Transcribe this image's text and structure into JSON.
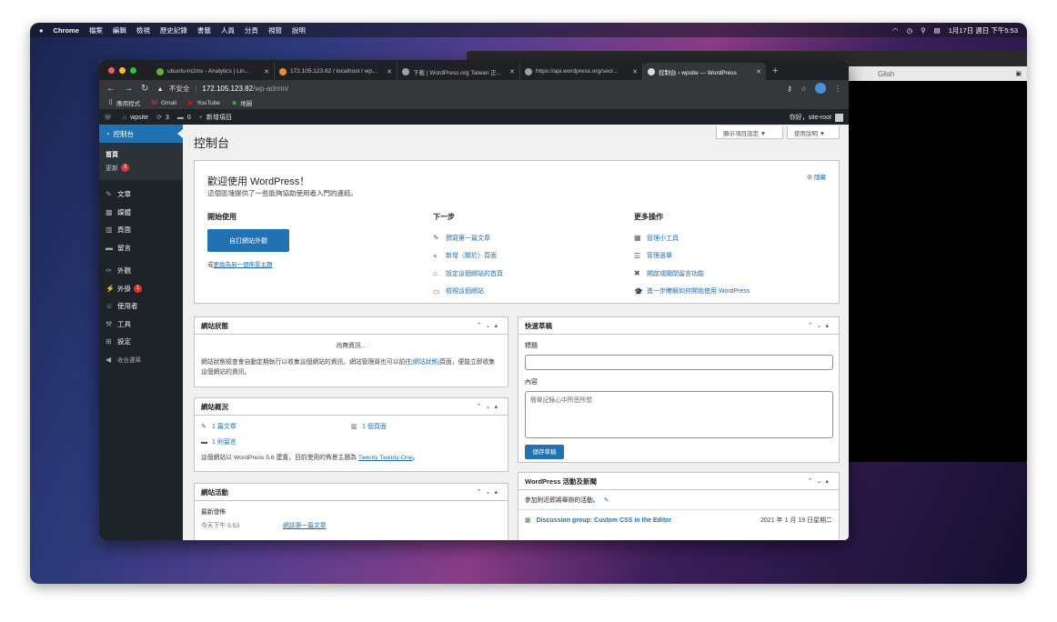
{
  "menubar": {
    "app_name": "Chrome",
    "menus": [
      "檔案",
      "編輯",
      "檢視",
      "歷史記錄",
      "書籤",
      "人員",
      "分頁",
      "視窗",
      "說明"
    ],
    "clock": "1月17日 週日 下午5:53"
  },
  "background_window": {
    "text": "Glish"
  },
  "browser": {
    "tabs": [
      {
        "title": "ubuntu-ln2ms - Analytics | Lin..."
      },
      {
        "title": "172.105.123.82 / localhost / wp..."
      },
      {
        "title": "下載 | WordPress.org Taiwan 正..."
      },
      {
        "title": "https://api.wordpress.org/secr..."
      },
      {
        "title": "控制台 ‹ wpsite — WordPress"
      }
    ],
    "insecure_label": "不安全",
    "url_host": "172.105.123.82",
    "url_path": "/wp-admin/",
    "bookmarks": [
      {
        "label": "應用程式",
        "icon": "apps-grid-icon"
      },
      {
        "label": "Gmail",
        "icon": "gmail-icon"
      },
      {
        "label": "YouTube",
        "icon": "youtube-icon"
      },
      {
        "label": "地圖",
        "icon": "maps-icon"
      }
    ]
  },
  "adminbar": {
    "site_name": "wpsite",
    "updates_count": "3",
    "comments_count": "0",
    "new_label": "新增項目",
    "greeting": "你好，site-root"
  },
  "sidebar": {
    "dashboard": "控制台",
    "home": "首頁",
    "updates": "更新",
    "updates_badge": "3",
    "posts": "文章",
    "media": "媒體",
    "pages": "頁面",
    "comments": "留言",
    "appearance": "外觀",
    "plugins": "外掛",
    "plugins_badge": "1",
    "users": "使用者",
    "tools": "工具",
    "settings": "設定",
    "collapse": "收合選單"
  },
  "page": {
    "title": "控制台",
    "screen_options": "顯示項目設定 ▼",
    "help": "使用說明 ▼"
  },
  "welcome": {
    "title": "歡迎使用 WordPress！",
    "about": "這個區塊提供了一些能夠協助使用者入門的連結。",
    "dismiss": "隱藏",
    "get_started": "開始使用",
    "customize_button": "自訂網站外觀",
    "or_prefix": "或",
    "change_theme_link": "更換為另一個佈景主題",
    "next_steps": "下一步",
    "next_links": [
      "撰寫第一篇文章",
      "新增〈關於〉頁面",
      "設定這個網站的首頁",
      "檢視這個網站"
    ],
    "more_actions": "更多操作",
    "more_links": [
      "管理小工具",
      "管理選單",
      "開啟或關閉留言功能",
      "進一步瞭解如何開始使用 WordPress"
    ]
  },
  "site_health": {
    "title": "網站狀態",
    "loading": "尚無資訊...",
    "text_before": "網站狀態檢查會自動定期執行以收集這個網站的資訊。網站管理員也可以前往",
    "link": "[網站狀態]",
    "text_after": "頁面，便能立即收集這個網站的資訊。"
  },
  "at_a_glance": {
    "title": "網站概況",
    "posts": "1 篇文章",
    "pages": "1 個頁面",
    "comments": "1 則留言",
    "footer_before": "這個網站以 WordPress 5.6 建置，目前使用的佈景主題為",
    "theme_link": "Twenty Twenty-One",
    "footer_after": "。"
  },
  "activity": {
    "title": "網站活動",
    "recently_published": "最新發佈",
    "item_time": "今天下午 5:53",
    "item_title": "網誌第一篇文章"
  },
  "quick_draft": {
    "title": "快速草稿",
    "title_label": "標題",
    "content_label": "內容",
    "content_placeholder": "簡單記錄心中所思所想",
    "save_button": "儲存草稿"
  },
  "events": {
    "title": "WordPress 活動及新聞",
    "attend_text": "參加附近即將舉辦的活動。",
    "event_title": "Discussion group: Custom CSS in the Editor",
    "event_date": "2021 年 1 月 19 日星期二"
  },
  "colors": {
    "wp_blue": "#2271b1",
    "admin_dark": "#1d2327",
    "badge_red": "#d63638"
  }
}
